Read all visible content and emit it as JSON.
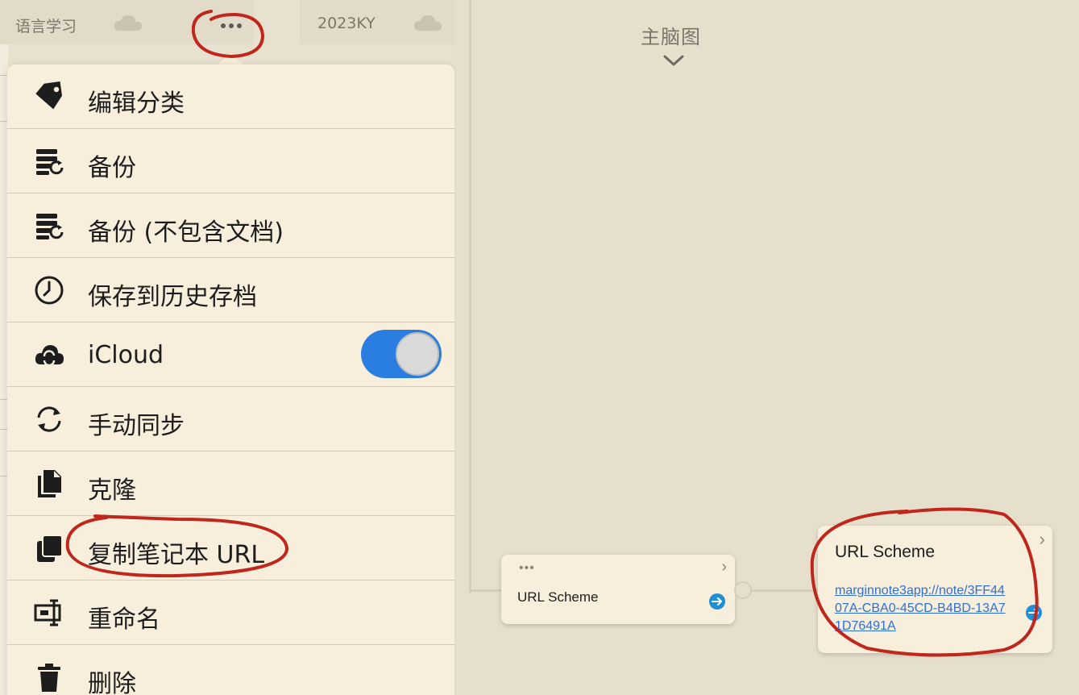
{
  "tabs": [
    {
      "title": "语言学习",
      "icon": "cloud-icon"
    },
    {
      "title": "2023KY",
      "icon": "cloud-icon"
    }
  ],
  "more_button": {
    "icon": "more-dots-icon"
  },
  "menu": {
    "items": [
      {
        "label": "编辑分类",
        "icon": "tag-icon"
      },
      {
        "label": "备份",
        "icon": "backup-icon"
      },
      {
        "label": "备份 (不包含文档)",
        "icon": "backup-icon"
      },
      {
        "label": "保存到历史存档",
        "icon": "history-clock-icon"
      },
      {
        "label": "iCloud",
        "icon": "icloud-sync-icon",
        "toggle_on": true
      },
      {
        "label": "手动同步",
        "icon": "sync-arrows-icon"
      },
      {
        "label": "克隆",
        "icon": "copy-documents-icon"
      },
      {
        "label": "复制笔记本 URL",
        "icon": "copy-url-icon"
      },
      {
        "label": "重命名",
        "icon": "rename-icon"
      },
      {
        "label": "删除",
        "icon": "trash-icon"
      }
    ]
  },
  "canvas": {
    "mindmap_title": "主脑图",
    "node_1": {
      "dots": "•••",
      "title": "URL Scheme"
    },
    "node_2": {
      "title": "URL Scheme",
      "link": "marginnote3app://note/3FF4407A-CBA0-45CD-B4BD-13A71D76491A"
    }
  },
  "colors": {
    "background": "#e6dfcc",
    "menu_bg": "#f7eedc",
    "toggle_on": "#2a7de1",
    "link": "#2f6fd0",
    "annotation_red": "#c0271c"
  }
}
